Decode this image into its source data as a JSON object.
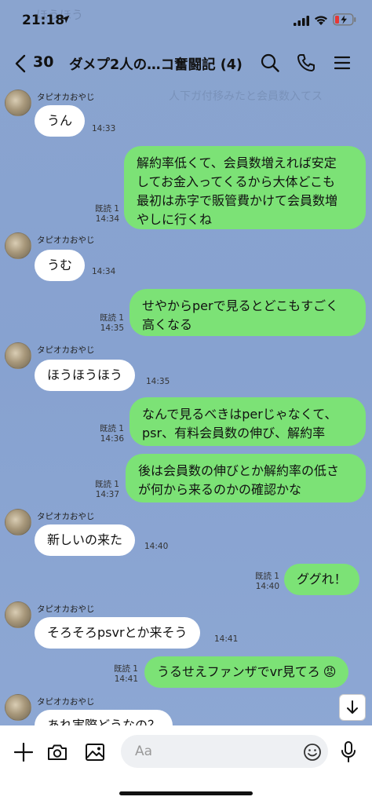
{
  "status": {
    "time": "21:18",
    "ghost": "ほうほう"
  },
  "header": {
    "back_count": "30",
    "title": "ダメプ2人の…コ奮闘記 (4)",
    "ghost": "人下ガ付移みたと会員数入てス"
  },
  "messages": [
    {
      "dir": "in",
      "sender": "タピオカおやじ",
      "lines": [
        "うん"
      ],
      "time": "14:33"
    },
    {
      "dir": "out",
      "read": "既読 1",
      "lines": [
        "解約率低くて、会員数増えれば安定",
        "してお金入ってくるから大体どこも",
        "最初は赤字で販管費かけて会員数増",
        "やしに行くね"
      ],
      "time": "14:34"
    },
    {
      "dir": "in",
      "sender": "タピオカおやじ",
      "lines": [
        "うむ"
      ],
      "time": "14:34"
    },
    {
      "dir": "out",
      "read": "既読 1",
      "lines": [
        "せやからperで見るとどこもすごく",
        "高くなる"
      ],
      "time": "14:35"
    },
    {
      "dir": "in",
      "sender": "タピオカおやじ",
      "lines": [
        "ほうほうほう"
      ],
      "time": "14:35"
    },
    {
      "dir": "out",
      "read": "既読 1",
      "lines": [
        "なんで見るべきはperじゃなくて、",
        "psr、有料会員数の伸び、解約率"
      ],
      "time": "14:36"
    },
    {
      "dir": "out",
      "read": "既読 1",
      "lines": [
        "後は会員数の伸びとか解約率の低さ",
        "が何から来るのかの確認かな"
      ],
      "time": "14:37"
    },
    {
      "dir": "in",
      "sender": "タピオカおやじ",
      "lines": [
        "新しいの来た"
      ],
      "time": "14:40"
    },
    {
      "dir": "out",
      "read": "既読 1",
      "lines": [
        "ググれ！"
      ],
      "time": "14:40"
    },
    {
      "dir": "in",
      "sender": "タピオカおやじ",
      "lines": [
        "そろそろpsvrとか来そう"
      ],
      "time": "14:41"
    },
    {
      "dir": "out",
      "read": "既読 1",
      "lines": [
        "うるせえファンザでvr見てろ"
      ],
      "emoji": "😡",
      "time": "14:41"
    },
    {
      "dir": "in",
      "sender": "タピオカおやじ",
      "lines": [
        "あれ実際どうなの？"
      ],
      "time": ""
    }
  ],
  "input": {
    "placeholder": "Aa"
  },
  "colors": {
    "background": "#8aa4cf",
    "outgoing_bubble": "#7ce276",
    "incoming_bubble": "#ffffff"
  }
}
